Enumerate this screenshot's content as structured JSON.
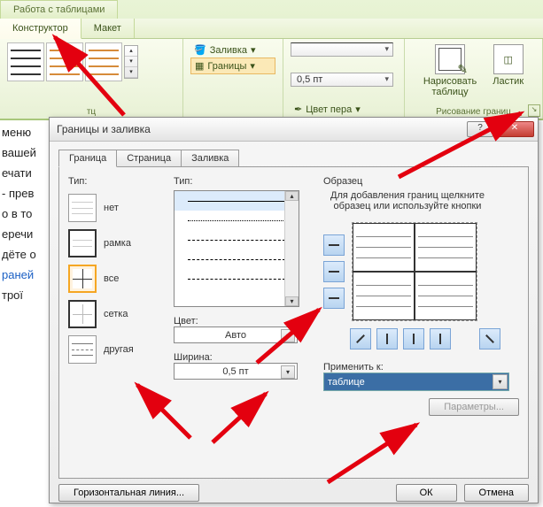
{
  "ribbon": {
    "context_title": "Работа с таблицами",
    "tabs": {
      "design": "Конструктор",
      "layout": "Макет"
    },
    "shading": "Заливка",
    "borders": "Границы",
    "pen_weight": "0,5 пт",
    "pen_color": "Цвет пера",
    "draw_table": "Нарисовать\nтаблицу",
    "eraser": "Ластик",
    "group_draw": "Рисование границ",
    "group_styles_trunc": "тц"
  },
  "doc_fragments": [
    "меню",
    "вашей",
    "ечати",
    "",
    "- прев",
    "о в то",
    "еречи",
    "дёте о",
    "",
    "раней",
    "трої"
  ],
  "dialog": {
    "title": "Границы и заливка",
    "help": "?",
    "tabs": {
      "border": "Граница",
      "page": "Страница",
      "fill": "Заливка"
    },
    "type_label": "Тип:",
    "types": {
      "none": "нет",
      "box": "рамка",
      "all": "все",
      "grid": "сетка",
      "custom": "другая"
    },
    "style_label": "Тип:",
    "color_label": "Цвет:",
    "color_value": "Авто",
    "width_label": "Ширина:",
    "width_value": "0,5 пт",
    "preview_label": "Образец",
    "preview_hint": "Для добавления границ щелкните образец или используйте кнопки",
    "apply_label": "Применить к:",
    "apply_value": "таблице",
    "options_btn": "Параметры...",
    "hline_btn": "Горизонтальная линия...",
    "ok": "ОК",
    "cancel": "Отмена"
  }
}
